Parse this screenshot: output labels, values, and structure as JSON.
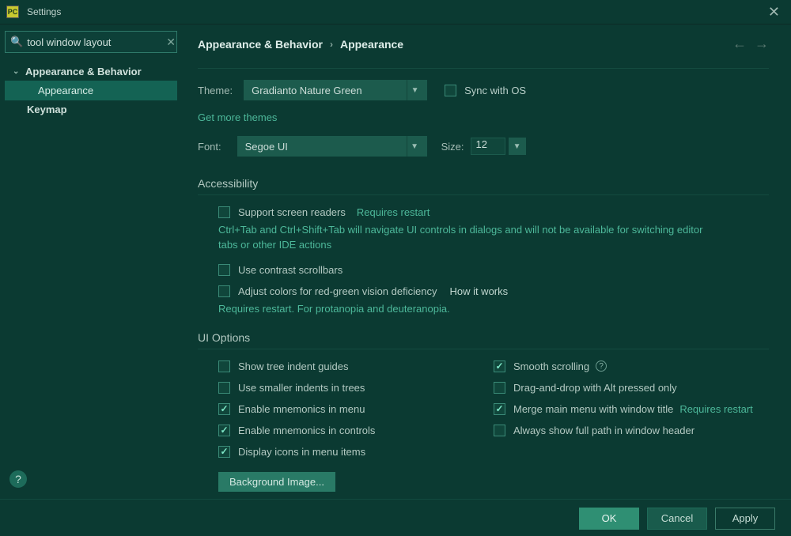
{
  "window": {
    "title": "Settings"
  },
  "search": {
    "value": "tool window layout"
  },
  "sidebar": {
    "root": "Appearance & Behavior",
    "selected": "Appearance",
    "items": [
      "Keymap"
    ]
  },
  "breadcrumb": {
    "a": "Appearance & Behavior",
    "b": "Appearance"
  },
  "theme": {
    "label": "Theme:",
    "value": "Gradianto Nature Green",
    "sync_label": "Sync with OS",
    "get_more": "Get more themes"
  },
  "font": {
    "label": "Font:",
    "value": "Segoe UI",
    "size_label": "Size:",
    "size_value": "12"
  },
  "accessibility": {
    "title": "Accessibility",
    "screen_readers": "Support screen readers",
    "restart": "Requires restart",
    "screen_readers_hint": "Ctrl+Tab and Ctrl+Shift+Tab will navigate UI controls in dialogs and will not be available for switching editor tabs or other IDE actions",
    "contrast": "Use contrast scrollbars",
    "color_def": "Adjust colors for red-green vision deficiency",
    "how": "How it works",
    "color_hint": "Requires restart. For protanopia and deuteranopia."
  },
  "ui": {
    "title": "UI Options",
    "tree_guides": "Show tree indent guides",
    "smaller_indents": "Use smaller indents in trees",
    "mnem_menu": "Enable mnemonics in menu",
    "mnem_ctrl": "Enable mnemonics in controls",
    "display_icons": "Display icons in menu items",
    "smooth": "Smooth scrolling",
    "dnd_alt": "Drag-and-drop with Alt pressed only",
    "merge_menu": "Merge main menu with window title",
    "merge_hint": "Requires restart",
    "full_path": "Always show full path in window header",
    "bg_image": "Background Image..."
  },
  "footer": {
    "ok": "OK",
    "cancel": "Cancel",
    "apply": "Apply"
  }
}
